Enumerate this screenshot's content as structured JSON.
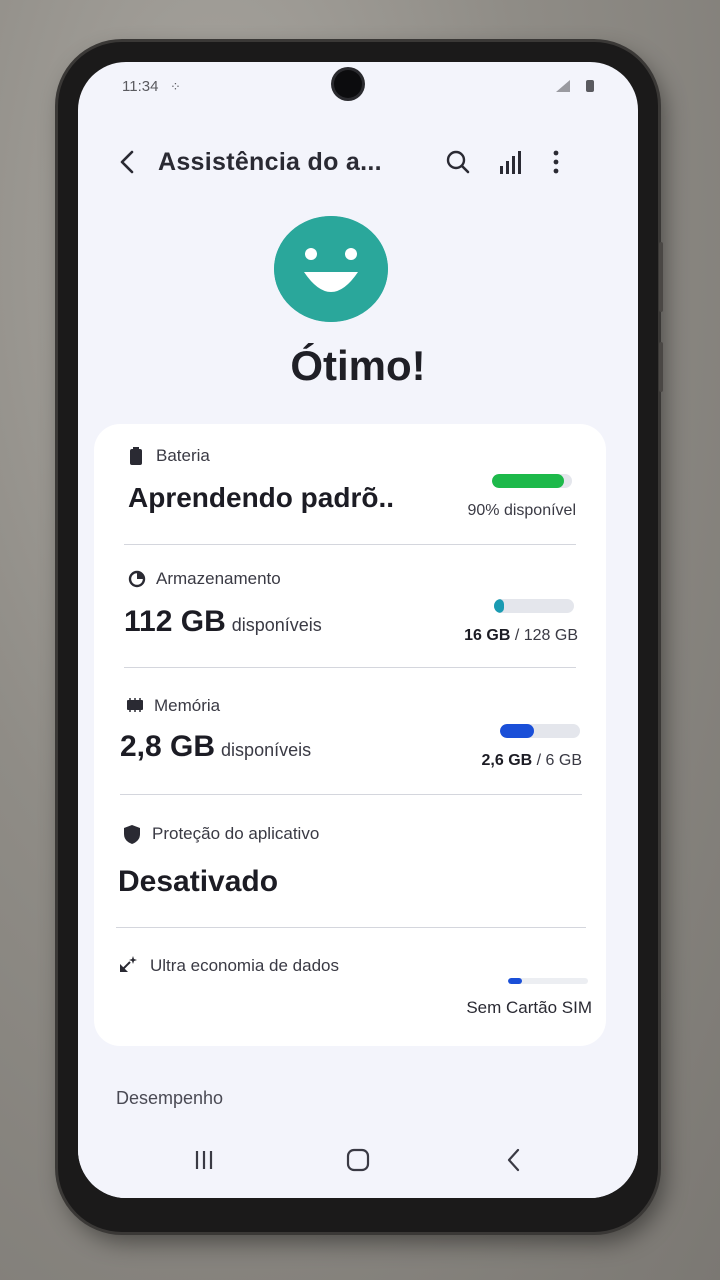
{
  "status_bar": {
    "time": "11:34"
  },
  "app_bar": {
    "title": "Assistência do a..."
  },
  "hero": {
    "status_text": "Ótimo!",
    "face_color": "#2aa79b"
  },
  "sections": {
    "battery": {
      "label": "Bateria",
      "value": "Aprendendo padrõ..",
      "side_text": "90% disponível",
      "level_fraction": 0.9,
      "bar_color": "#1db94a"
    },
    "storage": {
      "label": "Armazenamento",
      "value": "112 GB",
      "unit": "disponíveis",
      "used": "16 GB",
      "total": "/ 128 GB",
      "used_fraction": 0.125,
      "bar_color": "#1a9bb2"
    },
    "memory": {
      "label": "Memória",
      "value": "2,8 GB",
      "unit": "disponíveis",
      "used": "2,6 GB",
      "total": "/ 6 GB",
      "used_fraction": 0.43,
      "bar_color": "#1a4fd8"
    },
    "app_protection": {
      "label": "Proteção do aplicativo",
      "value": "Desativado"
    },
    "data_saver": {
      "label": "Ultra economia de dados",
      "side_text": "Sem Cartão SIM"
    }
  },
  "performance": {
    "label": "Desempenho"
  }
}
